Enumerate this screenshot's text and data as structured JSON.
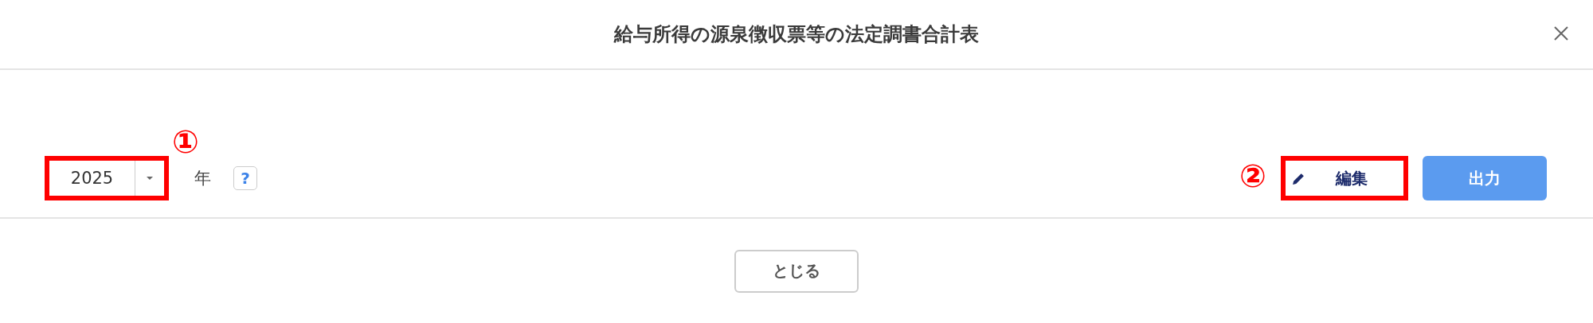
{
  "dialog": {
    "title": "給与所得の源泉徴収票等の法定調書合計表"
  },
  "year_select": {
    "value": "2025",
    "unit": "年",
    "highlighted": true,
    "marker": "①"
  },
  "help": {
    "label": "?"
  },
  "buttons": [
    {
      "kind": "edit",
      "label": "編集",
      "highlighted": true,
      "marker": "②"
    },
    {
      "kind": "primary",
      "label": "出力",
      "highlighted": false
    }
  ],
  "footer_buttons": [
    {
      "label": "とじる"
    }
  ]
}
